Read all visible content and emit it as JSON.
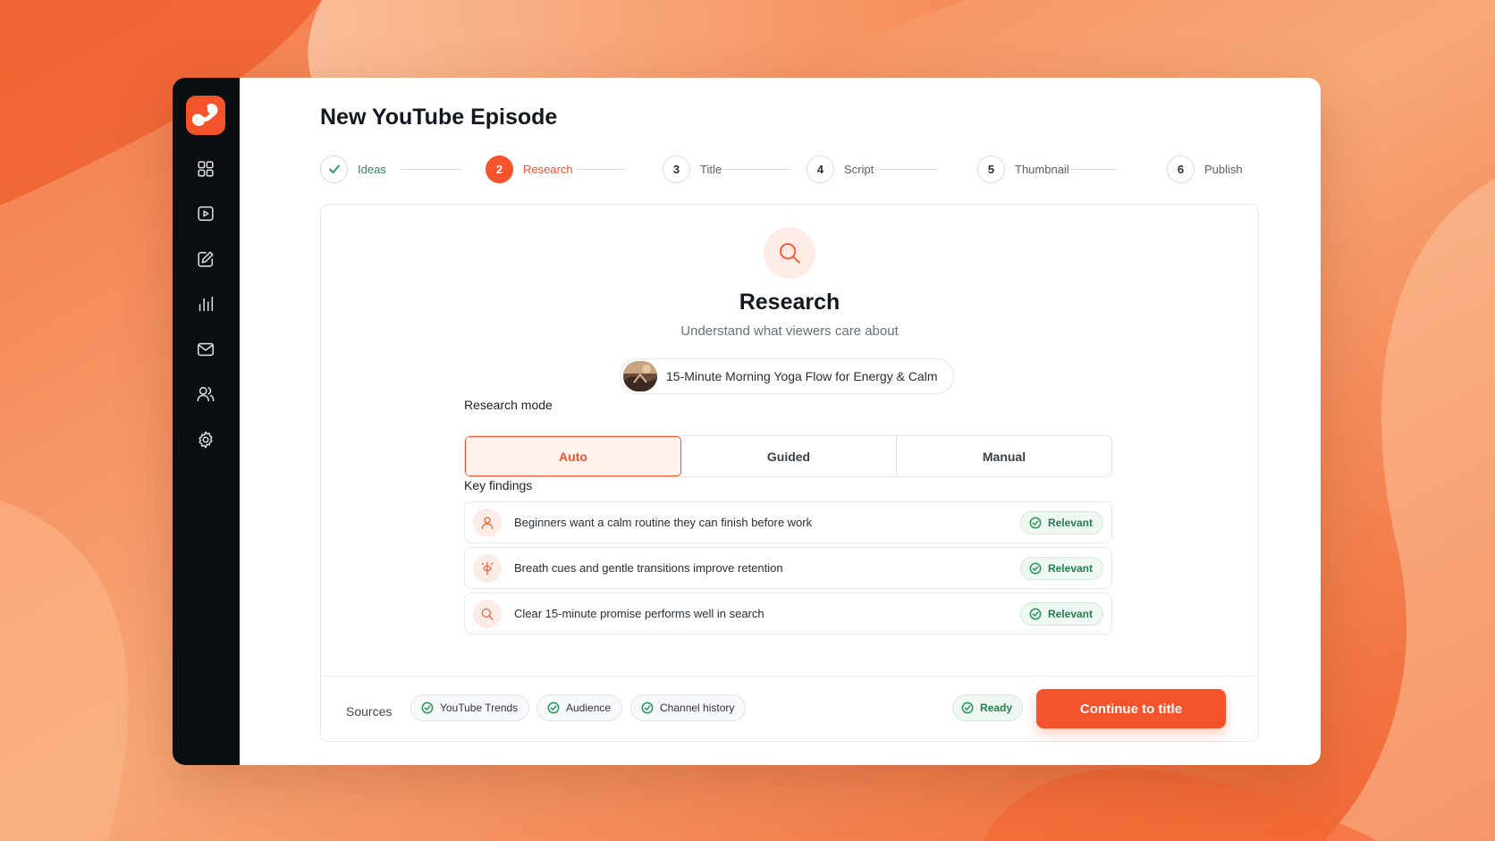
{
  "colors": {
    "accent": "#f5532c",
    "sidebar": "#0c0f12",
    "success": "#24804e",
    "background": "#f26a3c"
  },
  "sidebar": {
    "items": [
      {
        "icon": "dashboard-icon"
      },
      {
        "icon": "video-icon"
      },
      {
        "icon": "edit-icon"
      },
      {
        "icon": "analytics-icon"
      },
      {
        "icon": "mail-icon"
      },
      {
        "icon": "users-icon"
      },
      {
        "icon": "settings-icon"
      }
    ]
  },
  "page": {
    "title": "New YouTube Episode"
  },
  "stepper": {
    "steps": [
      {
        "number": "",
        "label": "Ideas",
        "state": "done"
      },
      {
        "number": "2",
        "label": "Research",
        "state": "active"
      },
      {
        "number": "3",
        "label": "Title",
        "state": "pending"
      },
      {
        "number": "4",
        "label": "Script",
        "state": "pending"
      },
      {
        "number": "5",
        "label": "Thumbnail",
        "state": "pending"
      },
      {
        "number": "6",
        "label": "Publish",
        "state": "pending"
      }
    ]
  },
  "research": {
    "title": "Research",
    "subtitle": "Understand what viewers care about",
    "topic": "15-Minute Morning Yoga Flow for Energy & Calm",
    "mode_label": "Research mode",
    "modes": [
      "Auto",
      "Guided",
      "Manual"
    ],
    "selected_mode": "Auto",
    "findings_label": "Key findings",
    "findings": [
      {
        "icon": "user-icon",
        "text": "Beginners want a calm routine they can finish before work",
        "badge": "Relevant"
      },
      {
        "icon": "breath-icon",
        "text": "Breath cues and gentle transitions improve retention",
        "badge": "Relevant"
      },
      {
        "icon": "search-icon",
        "text": "Clear 15-minute promise performs well in search",
        "badge": "Relevant"
      }
    ]
  },
  "footer": {
    "sources_label": "Sources",
    "sources": [
      "YouTube Trends",
      "Audience",
      "Channel history"
    ],
    "status": "Ready",
    "cta": "Continue to title"
  }
}
